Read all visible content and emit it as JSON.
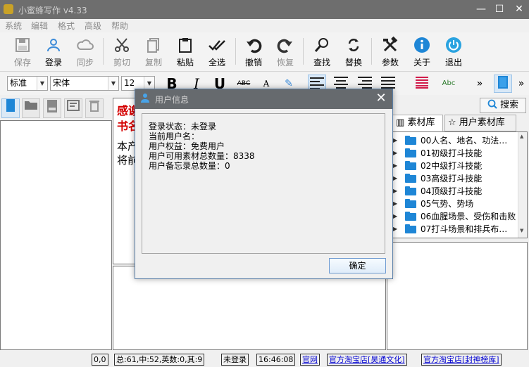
{
  "window": {
    "title": "小蜜蜂写作 v4.33",
    "minimize": "—",
    "maximize": "☐",
    "close": "✕"
  },
  "menu": [
    "系统",
    "编辑",
    "格式",
    "高级",
    "帮助"
  ],
  "toolbar": {
    "save": "保存",
    "login": "登录",
    "sync": "同步",
    "cut": "剪切",
    "copy": "复制",
    "paste": "粘贴",
    "select_all": "全选",
    "undo": "撤销",
    "redo": "恢复",
    "find": "查找",
    "replace": "替换",
    "settings": "参数",
    "about": "关于",
    "exit": "退出"
  },
  "format": {
    "style": "标准",
    "font": "宋体",
    "size": "12",
    "bold": "B",
    "italic": "I",
    "underline": "U",
    "strike": "ABC",
    "spell": "Abc",
    "more": "»"
  },
  "editor": {
    "line1": "感谢",
    "line2": "书名",
    "line3": "本产",
    "line4": "将前"
  },
  "right_panel": {
    "search_button": "搜索",
    "tab_material": "素材库",
    "tab_user_material": "用户素材库",
    "tree": [
      "00人名、地名、功法…",
      "01初级打斗技能",
      "02中级打斗技能",
      "03高级打斗技能",
      "04顶级打斗技能",
      "05气势、势场",
      "06血腥场景、受伤和击败",
      "07打斗场景和排兵布…"
    ]
  },
  "status": {
    "cursor": "0,0",
    "counts": "总:61,中:52,英数:0,其:9",
    "login_state": "未登录",
    "time": "16:46:08",
    "official_site": "官网",
    "shop1": "官方淘宝店[昊通文化]",
    "shop2": "官方淘宝店[封神榜库]"
  },
  "dialog": {
    "title": "用户信息",
    "lines": [
      "登录状态：未登录",
      "当前用户名：",
      "用户权益：免费用户",
      "用户可用素材总数量：8338",
      "用户备忘录总数量：0"
    ],
    "ok_button": "确定"
  },
  "colors": {
    "titlebar": "#6e6e6e",
    "accent_blue": "#1e86d6",
    "red_text": "#d40000"
  }
}
